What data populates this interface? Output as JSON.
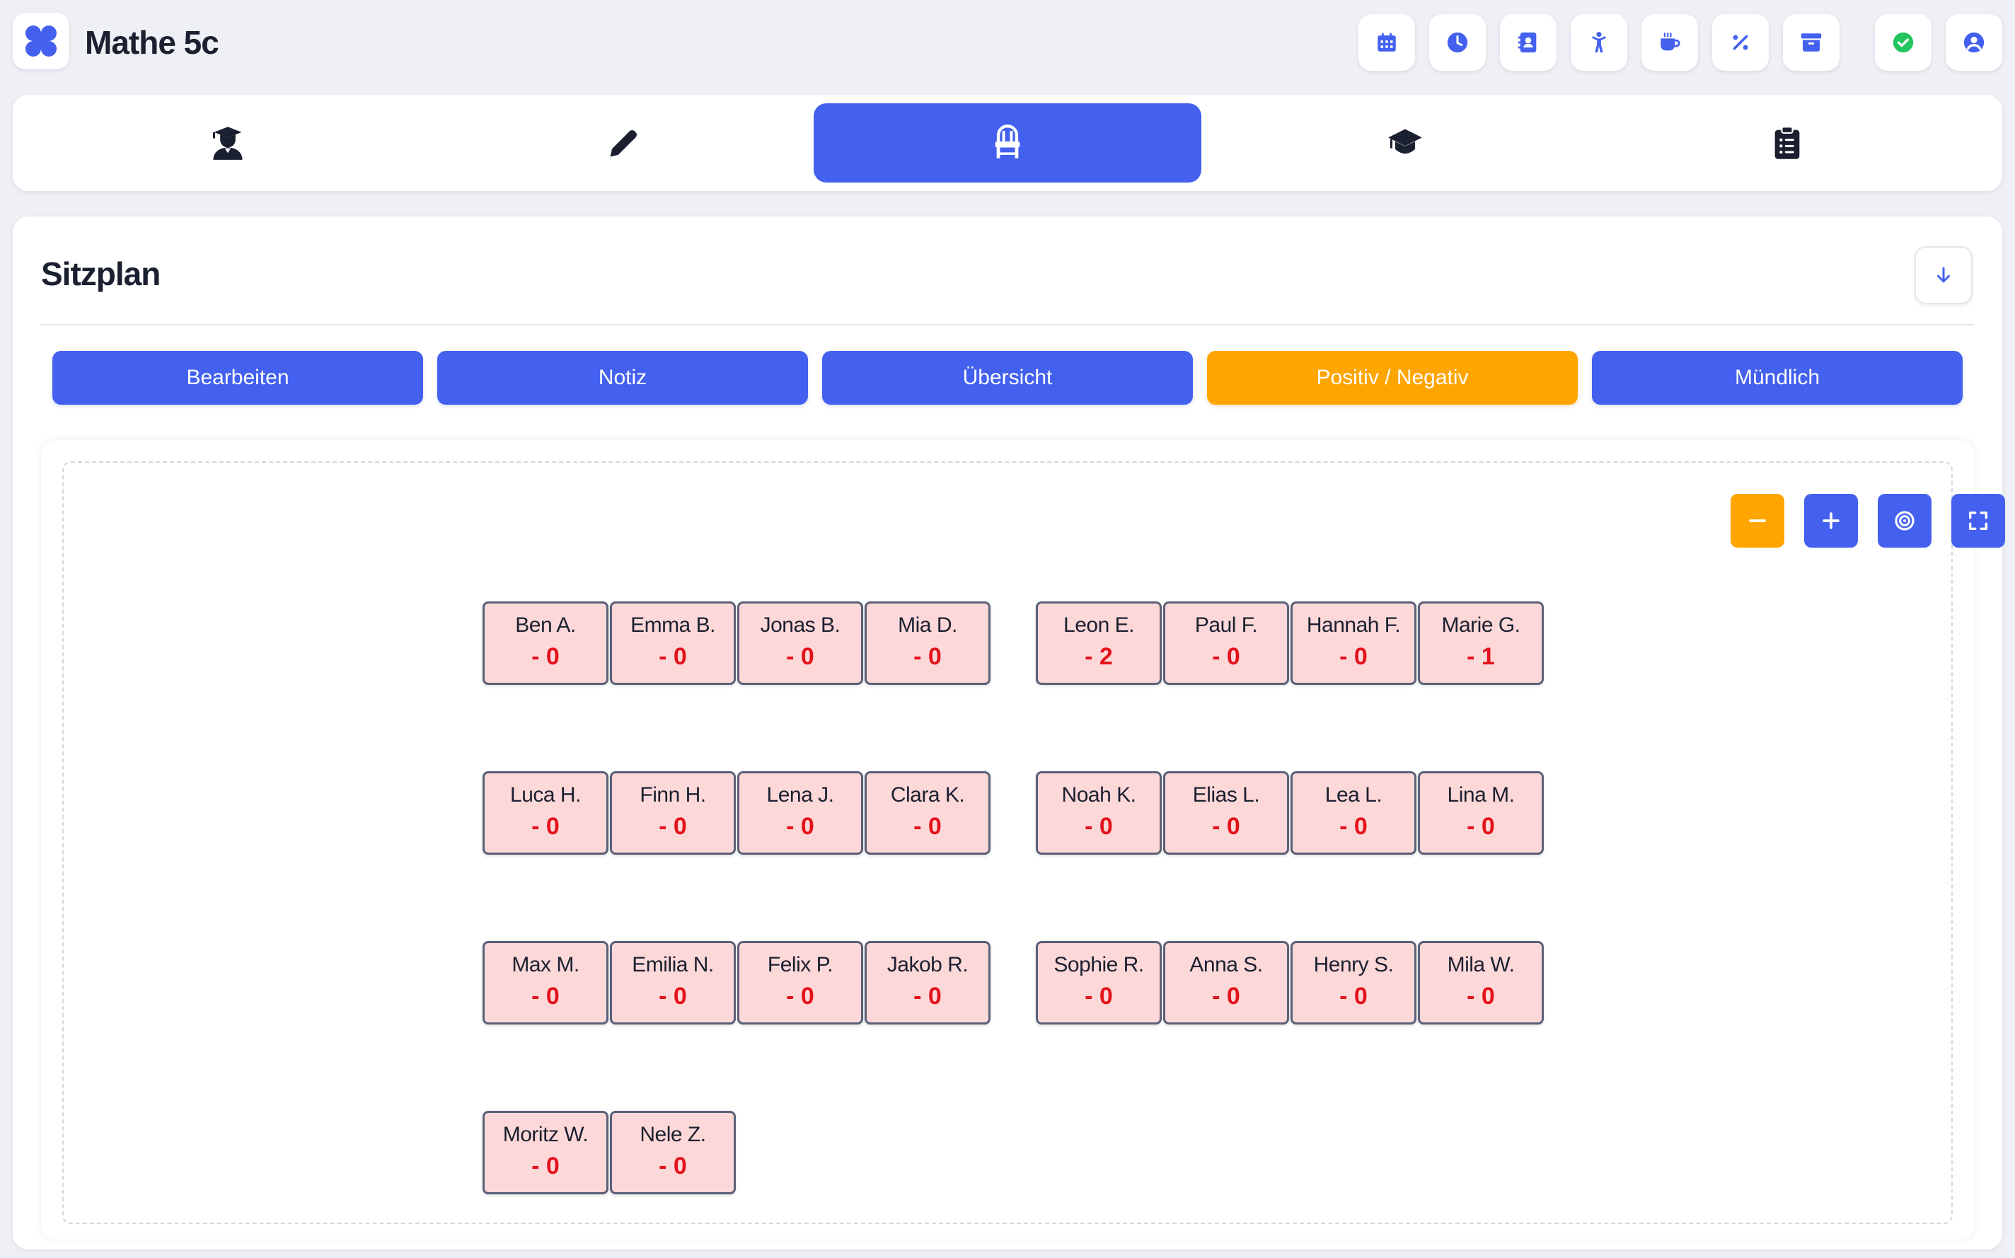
{
  "app": {
    "title": "Mathe 5c",
    "logo_icon": "apps-grid-icon",
    "accent": "#4361ee",
    "highlight": "#ffa500",
    "success": "#22c55e"
  },
  "header_buttons": [
    {
      "name": "calendar-icon"
    },
    {
      "name": "clock-icon"
    },
    {
      "name": "contact-book-icon"
    },
    {
      "name": "child-icon"
    },
    {
      "name": "coffee-cup-icon"
    },
    {
      "name": "percent-icon"
    },
    {
      "name": "archive-box-icon"
    },
    {
      "name": "check-circle-icon"
    },
    {
      "name": "user-profile-icon"
    }
  ],
  "tabs": [
    {
      "icon": "student-icon",
      "active": false
    },
    {
      "icon": "pencil-icon",
      "active": false
    },
    {
      "icon": "chair-icon",
      "active": true
    },
    {
      "icon": "graduation-cap-icon",
      "active": false
    },
    {
      "icon": "clipboard-list-icon",
      "active": false
    }
  ],
  "section": {
    "title": "Sitzplan",
    "collapse_icon": "arrow-down-icon"
  },
  "modes": [
    {
      "label": "Bearbeiten",
      "active": false
    },
    {
      "label": "Notiz",
      "active": false
    },
    {
      "label": "Übersicht",
      "active": false
    },
    {
      "label": "Positiv / Negativ",
      "active": true
    },
    {
      "label": "Mündlich",
      "active": false
    }
  ],
  "controls": [
    {
      "icon": "minus-icon"
    },
    {
      "icon": "plus-icon"
    },
    {
      "icon": "target-icon"
    },
    {
      "icon": "fullscreen-icon"
    }
  ],
  "seats": [
    {
      "name": "Ben A.",
      "score": "- 0"
    },
    {
      "name": "Emma B.",
      "score": "- 0"
    },
    {
      "name": "Jonas B.",
      "score": "- 0"
    },
    {
      "name": "Mia D.",
      "score": "- 0"
    },
    {
      "name": "Leon E.",
      "score": "- 2"
    },
    {
      "name": "Paul F.",
      "score": "- 0"
    },
    {
      "name": "Hannah F.",
      "score": "- 0"
    },
    {
      "name": "Marie G.",
      "score": "- 1"
    },
    {
      "name": "Luca H.",
      "score": "- 0"
    },
    {
      "name": "Finn H.",
      "score": "- 0"
    },
    {
      "name": "Lena J.",
      "score": "- 0"
    },
    {
      "name": "Clara K.",
      "score": "- 0"
    },
    {
      "name": "Noah K.",
      "score": "- 0"
    },
    {
      "name": "Elias L.",
      "score": "- 0"
    },
    {
      "name": "Lea L.",
      "score": "- 0"
    },
    {
      "name": "Lina M.",
      "score": "- 0"
    },
    {
      "name": "Max M.",
      "score": "- 0"
    },
    {
      "name": "Emilia N.",
      "score": "- 0"
    },
    {
      "name": "Felix P.",
      "score": "- 0"
    },
    {
      "name": "Jakob R.",
      "score": "- 0"
    },
    {
      "name": "Sophie R.",
      "score": "- 0"
    },
    {
      "name": "Anna S.",
      "score": "- 0"
    },
    {
      "name": "Henry S.",
      "score": "- 0"
    },
    {
      "name": "Mila W.",
      "score": "- 0"
    },
    {
      "name": "Moritz W.",
      "score": "- 0"
    },
    {
      "name": "Nele Z.",
      "score": "- 0"
    }
  ]
}
